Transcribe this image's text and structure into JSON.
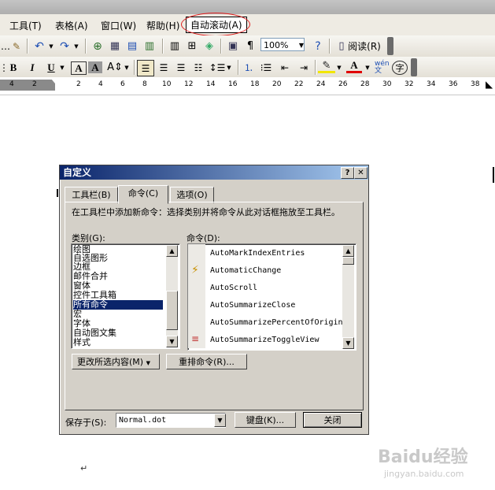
{
  "menubar": {
    "items": [
      "工具(T)",
      "表格(A)",
      "窗口(W)",
      "帮助(H)"
    ],
    "highlighted": "自动滚动(A)"
  },
  "toolbar1": {
    "zoom": "100%",
    "read_label": "阅读(R)"
  },
  "toolbar2": {
    "bold": "B",
    "italic": "I",
    "underline": "U",
    "char_border": "A",
    "char_shade": "A",
    "font_color": "A",
    "phonetic": "wén 文",
    "enclose": "字"
  },
  "ruler": {
    "labels": [
      "4",
      "2",
      "2",
      "4",
      "6",
      "8",
      "10",
      "12",
      "14",
      "16",
      "18",
      "20",
      "22",
      "24",
      "26",
      "28",
      "30",
      "32",
      "34",
      "36",
      "38"
    ]
  },
  "dialog": {
    "title": "自定义",
    "help": "?",
    "close": "✕",
    "tabs": [
      "工具栏(B)",
      "命令(C)",
      "选项(O)"
    ],
    "instructions": "在工具栏中添加新命令：选择类别并将命令从此对话框拖放至工具栏。",
    "categories_label": "类别(G):",
    "commands_label": "命令(D):",
    "categories": [
      "绘图",
      "自选图形",
      "边框",
      "邮件合并",
      "窗体",
      "控件工具箱",
      "所有命令",
      "宏",
      "字体",
      "自动图文集",
      "样式"
    ],
    "selected_category": "所有命令",
    "commands": [
      "AutoMarkIndexEntries",
      "AutomaticChange",
      "AutoScroll",
      "AutoSummarizeClose",
      "AutoSummarizePercentOfOrigin",
      "AutoSummarizeToggleView"
    ],
    "modify_selection": "更改所选内容(M)",
    "rearrange": "重排命令(R)...",
    "save_in_label": "保存于(S):",
    "save_in_value": "Normal.dot",
    "keyboard": "键盘(K)...",
    "close_button": "关闭"
  },
  "document": {
    "paragraph_mark": "↵"
  },
  "watermark": {
    "main": "Baidu经验",
    "sub": "jingyan.baidu.com"
  }
}
